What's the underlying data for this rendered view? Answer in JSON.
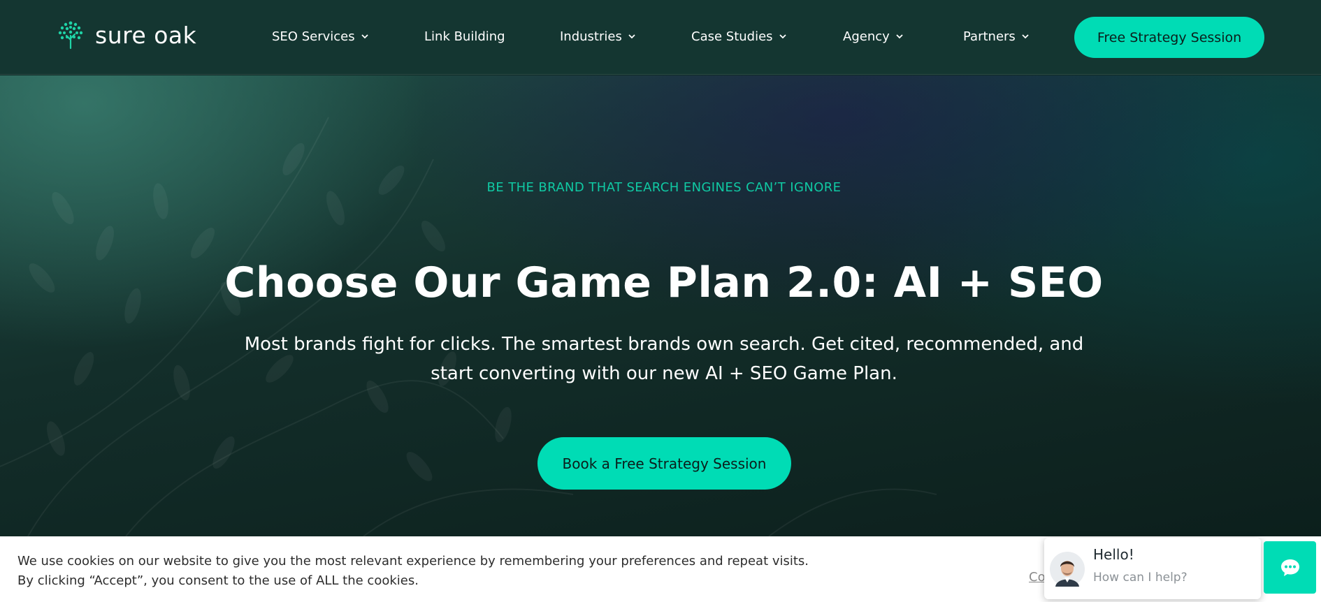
{
  "header": {
    "logo_text": "sure oak",
    "nav": [
      {
        "label": "SEO Services",
        "has_dropdown": true
      },
      {
        "label": "Link Building",
        "has_dropdown": false
      },
      {
        "label": "Industries",
        "has_dropdown": true
      },
      {
        "label": "Case Studies",
        "has_dropdown": true
      },
      {
        "label": "Agency",
        "has_dropdown": true
      },
      {
        "label": "Partners",
        "has_dropdown": true
      }
    ],
    "cta_label": "Free Strategy Session"
  },
  "hero": {
    "eyebrow": "BE THE BRAND THAT SEARCH ENGINES CAN’T IGNORE",
    "title": "Choose Our Game Plan 2.0: AI + SEO",
    "subtitle": "Most brands fight for clicks. The smartest brands own search. Get cited, recommended, and start converting with our new AI + SEO Game Plan.",
    "cta_label": "Book a Free Strategy Session"
  },
  "cookie": {
    "text_line1": "We use cookies on our website to give you the most relevant experience by remembering your preferences and repeat visits.",
    "text_line2": "By clicking “Accept”, you consent to the use of ALL the cookies.",
    "settings_link_partial": "Co"
  },
  "chat": {
    "greeting": "Hello!",
    "prompt": "How can I help?",
    "avatar_icon": "person-avatar-icon",
    "button_icon": "chat-bubble-icon"
  },
  "colors": {
    "accent": "#00dcb5",
    "eyebrow": "#10c9a3",
    "header_bg": "#143631"
  }
}
